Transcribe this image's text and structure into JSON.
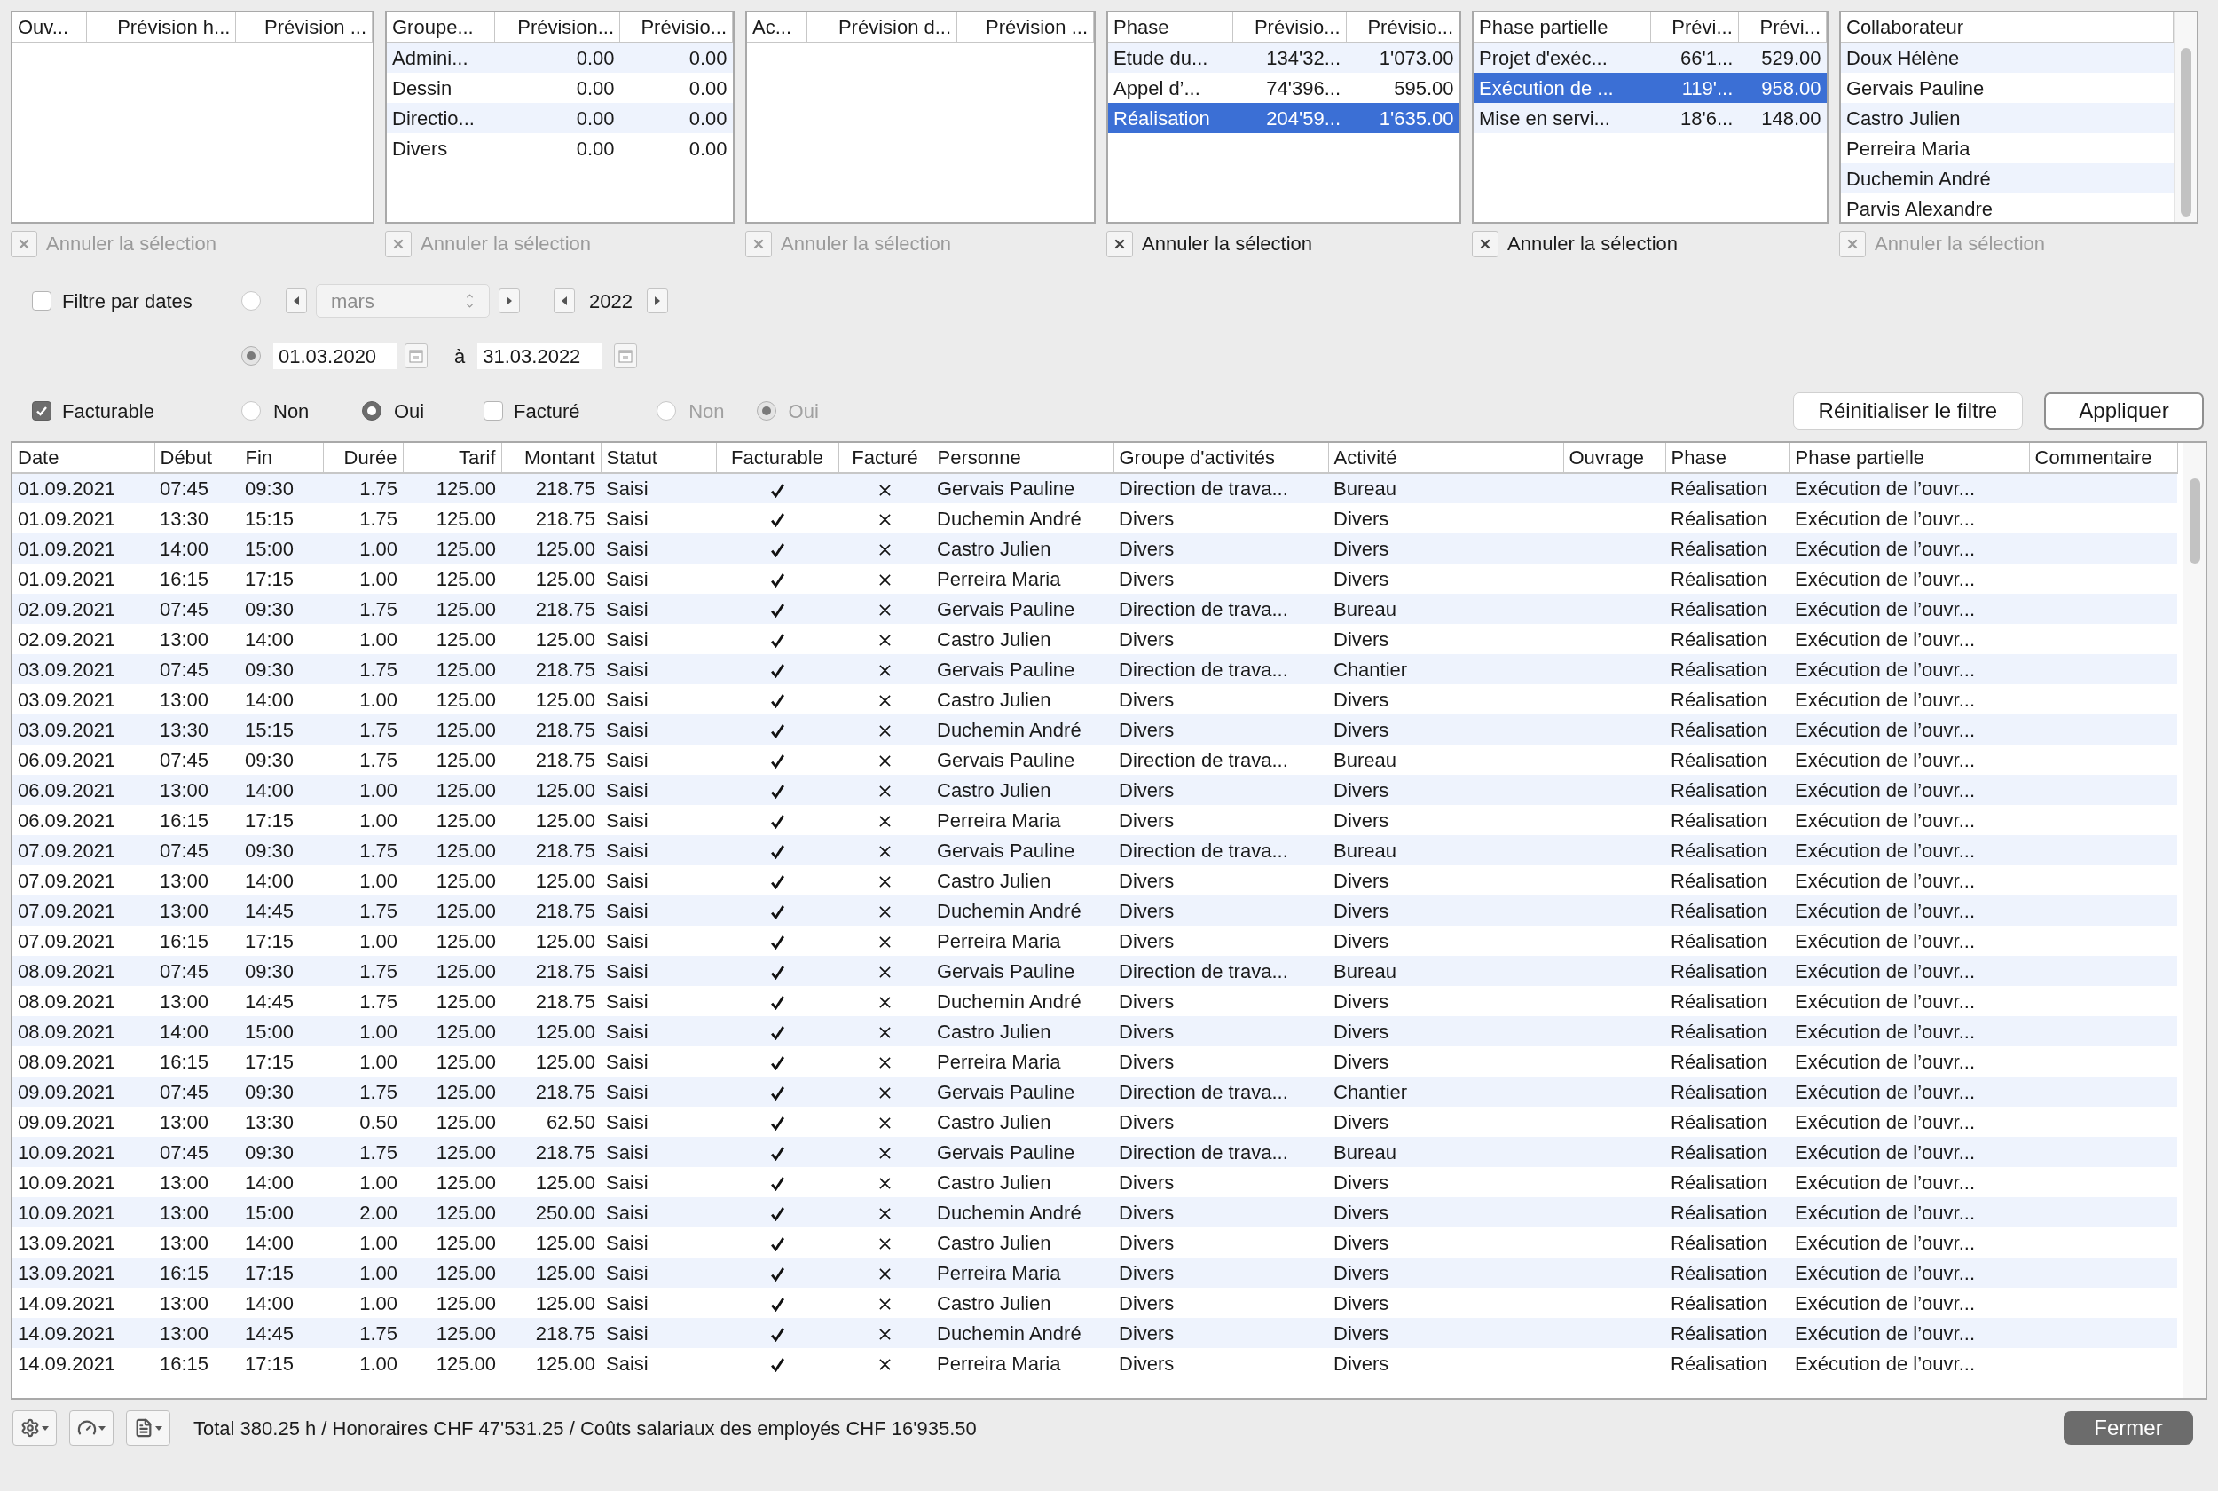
{
  "panels": [
    {
      "columns": [
        "Ouv...",
        "Prévision h...",
        "Prévision ..."
      ],
      "clear_button": {
        "label": "Annuler la sélection",
        "disabled": true
      }
    },
    {
      "columns": [
        "Groupe...",
        "Prévision...",
        "Prévisio..."
      ],
      "rows": [
        {
          "cells": [
            "Admini...",
            "0.00",
            "0.00"
          ],
          "selected": false
        },
        {
          "cells": [
            "Dessin",
            "0.00",
            "0.00"
          ],
          "selected": false
        },
        {
          "cells": [
            "Directio...",
            "0.00",
            "0.00"
          ],
          "selected": false
        },
        {
          "cells": [
            "Divers",
            "0.00",
            "0.00"
          ],
          "selected": false
        }
      ],
      "clear_button": {
        "label": "Annuler la sélection",
        "disabled": true
      }
    },
    {
      "columns": [
        "Ac...",
        "Prévision d...",
        "Prévision ..."
      ],
      "clear_button": {
        "label": "Annuler la sélection",
        "disabled": true
      }
    },
    {
      "columns": [
        "Phase",
        "Prévisio...",
        "Prévisio..."
      ],
      "rows": [
        {
          "cells": [
            "Etude du...",
            "134'32...",
            "1'073.00"
          ],
          "selected": false
        },
        {
          "cells": [
            "Appel d’...",
            "74'396...",
            "595.00"
          ],
          "selected": false
        },
        {
          "cells": [
            "Réalisation",
            "204'59...",
            "1'635.00"
          ],
          "selected": true
        }
      ],
      "clear_button": {
        "label": "Annuler la sélection",
        "disabled": false
      }
    },
    {
      "columns": [
        "Phase partielle",
        "Prévi...",
        "Prévi..."
      ],
      "rows": [
        {
          "cells": [
            "Projet d'exéc...",
            "66'1...",
            "529.00"
          ],
          "selected": false
        },
        {
          "cells": [
            "Exécution de ...",
            "119'...",
            "958.00"
          ],
          "selected": true
        },
        {
          "cells": [
            "Mise en servi...",
            "18'6...",
            "148.00"
          ],
          "selected": false
        }
      ],
      "clear_button": {
        "label": "Annuler la sélection",
        "disabled": false
      }
    },
    {
      "columns": [
        "Collaborateur"
      ],
      "scrollable": true,
      "rows": [
        {
          "cells": [
            "Doux Hélène"
          ],
          "selected": false
        },
        {
          "cells": [
            "Gervais Pauline"
          ],
          "selected": false
        },
        {
          "cells": [
            "Castro Julien"
          ],
          "selected": false
        },
        {
          "cells": [
            "Perreira Maria"
          ],
          "selected": false
        },
        {
          "cells": [
            "Duchemin André"
          ],
          "selected": false
        },
        {
          "cells": [
            "Parvis Alexandre"
          ],
          "selected": false
        }
      ],
      "clear_button": {
        "label": "Annuler la sélection",
        "disabled": true
      }
    }
  ],
  "date_filter": {
    "label": "Filtre par dates",
    "checked": false,
    "month_option": {
      "selected": false
    },
    "month": "mars",
    "year": "2022",
    "range_option": {
      "selected": true
    },
    "from": "01.03.2020",
    "separator": "à",
    "to": "31.03.2022"
  },
  "options": [
    {
      "label": "Facturable",
      "checked": true,
      "disabled": false,
      "choices": [
        {
          "label": "Non",
          "selected": false
        },
        {
          "label": "Oui",
          "selected": true
        }
      ]
    },
    {
      "label": "Facturé",
      "checked": false,
      "disabled": true,
      "choices": [
        {
          "label": "Non",
          "selected": false
        },
        {
          "label": "Oui",
          "selected": true
        }
      ]
    }
  ],
  "buttons": [
    {
      "label": "Réinitialiser le filtre",
      "default": false
    },
    {
      "label": "Appliquer",
      "default": true
    }
  ],
  "table": {
    "columns": [
      "Date",
      "Début",
      "Fin",
      "Durée",
      "Tarif",
      "Montant",
      "Statut",
      "Facturable",
      "Facturé",
      "Personne",
      "Groupe d'activités",
      "Activité",
      "Ouvrage",
      "Phase",
      "Phase partielle",
      "Commentaire"
    ],
    "rows": [
      [
        "01.09.2021",
        "07:45",
        "09:30",
        "1.75",
        "125.00",
        "218.75",
        "Saisi",
        true,
        false,
        "Gervais Pauline",
        "Direction de trava...",
        "Bureau",
        "",
        "Réalisation",
        "Exécution de l’ouvr...",
        ""
      ],
      [
        "01.09.2021",
        "13:30",
        "15:15",
        "1.75",
        "125.00",
        "218.75",
        "Saisi",
        true,
        false,
        "Duchemin André",
        "Divers",
        "Divers",
        "",
        "Réalisation",
        "Exécution de l’ouvr...",
        ""
      ],
      [
        "01.09.2021",
        "14:00",
        "15:00",
        "1.00",
        "125.00",
        "125.00",
        "Saisi",
        true,
        false,
        "Castro Julien",
        "Divers",
        "Divers",
        "",
        "Réalisation",
        "Exécution de l’ouvr...",
        ""
      ],
      [
        "01.09.2021",
        "16:15",
        "17:15",
        "1.00",
        "125.00",
        "125.00",
        "Saisi",
        true,
        false,
        "Perreira Maria",
        "Divers",
        "Divers",
        "",
        "Réalisation",
        "Exécution de l’ouvr...",
        ""
      ],
      [
        "02.09.2021",
        "07:45",
        "09:30",
        "1.75",
        "125.00",
        "218.75",
        "Saisi",
        true,
        false,
        "Gervais Pauline",
        "Direction de trava...",
        "Bureau",
        "",
        "Réalisation",
        "Exécution de l’ouvr...",
        ""
      ],
      [
        "02.09.2021",
        "13:00",
        "14:00",
        "1.00",
        "125.00",
        "125.00",
        "Saisi",
        true,
        false,
        "Castro Julien",
        "Divers",
        "Divers",
        "",
        "Réalisation",
        "Exécution de l’ouvr...",
        ""
      ],
      [
        "03.09.2021",
        "07:45",
        "09:30",
        "1.75",
        "125.00",
        "218.75",
        "Saisi",
        true,
        false,
        "Gervais Pauline",
        "Direction de trava...",
        "Chantier",
        "",
        "Réalisation",
        "Exécution de l’ouvr...",
        ""
      ],
      [
        "03.09.2021",
        "13:00",
        "14:00",
        "1.00",
        "125.00",
        "125.00",
        "Saisi",
        true,
        false,
        "Castro Julien",
        "Divers",
        "Divers",
        "",
        "Réalisation",
        "Exécution de l’ouvr...",
        ""
      ],
      [
        "03.09.2021",
        "13:30",
        "15:15",
        "1.75",
        "125.00",
        "218.75",
        "Saisi",
        true,
        false,
        "Duchemin André",
        "Divers",
        "Divers",
        "",
        "Réalisation",
        "Exécution de l’ouvr...",
        ""
      ],
      [
        "06.09.2021",
        "07:45",
        "09:30",
        "1.75",
        "125.00",
        "218.75",
        "Saisi",
        true,
        false,
        "Gervais Pauline",
        "Direction de trava...",
        "Bureau",
        "",
        "Réalisation",
        "Exécution de l’ouvr...",
        ""
      ],
      [
        "06.09.2021",
        "13:00",
        "14:00",
        "1.00",
        "125.00",
        "125.00",
        "Saisi",
        true,
        false,
        "Castro Julien",
        "Divers",
        "Divers",
        "",
        "Réalisation",
        "Exécution de l’ouvr...",
        ""
      ],
      [
        "06.09.2021",
        "16:15",
        "17:15",
        "1.00",
        "125.00",
        "125.00",
        "Saisi",
        true,
        false,
        "Perreira Maria",
        "Divers",
        "Divers",
        "",
        "Réalisation",
        "Exécution de l’ouvr...",
        ""
      ],
      [
        "07.09.2021",
        "07:45",
        "09:30",
        "1.75",
        "125.00",
        "218.75",
        "Saisi",
        true,
        false,
        "Gervais Pauline",
        "Direction de trava...",
        "Bureau",
        "",
        "Réalisation",
        "Exécution de l’ouvr...",
        ""
      ],
      [
        "07.09.2021",
        "13:00",
        "14:00",
        "1.00",
        "125.00",
        "125.00",
        "Saisi",
        true,
        false,
        "Castro Julien",
        "Divers",
        "Divers",
        "",
        "Réalisation",
        "Exécution de l’ouvr...",
        ""
      ],
      [
        "07.09.2021",
        "13:00",
        "14:45",
        "1.75",
        "125.00",
        "218.75",
        "Saisi",
        true,
        false,
        "Duchemin André",
        "Divers",
        "Divers",
        "",
        "Réalisation",
        "Exécution de l’ouvr...",
        ""
      ],
      [
        "07.09.2021",
        "16:15",
        "17:15",
        "1.00",
        "125.00",
        "125.00",
        "Saisi",
        true,
        false,
        "Perreira Maria",
        "Divers",
        "Divers",
        "",
        "Réalisation",
        "Exécution de l’ouvr...",
        ""
      ],
      [
        "08.09.2021",
        "07:45",
        "09:30",
        "1.75",
        "125.00",
        "218.75",
        "Saisi",
        true,
        false,
        "Gervais Pauline",
        "Direction de trava...",
        "Bureau",
        "",
        "Réalisation",
        "Exécution de l’ouvr...",
        ""
      ],
      [
        "08.09.2021",
        "13:00",
        "14:45",
        "1.75",
        "125.00",
        "218.75",
        "Saisi",
        true,
        false,
        "Duchemin André",
        "Divers",
        "Divers",
        "",
        "Réalisation",
        "Exécution de l’ouvr...",
        ""
      ],
      [
        "08.09.2021",
        "14:00",
        "15:00",
        "1.00",
        "125.00",
        "125.00",
        "Saisi",
        true,
        false,
        "Castro Julien",
        "Divers",
        "Divers",
        "",
        "Réalisation",
        "Exécution de l’ouvr...",
        ""
      ],
      [
        "08.09.2021",
        "16:15",
        "17:15",
        "1.00",
        "125.00",
        "125.00",
        "Saisi",
        true,
        false,
        "Perreira Maria",
        "Divers",
        "Divers",
        "",
        "Réalisation",
        "Exécution de l’ouvr...",
        ""
      ],
      [
        "09.09.2021",
        "07:45",
        "09:30",
        "1.75",
        "125.00",
        "218.75",
        "Saisi",
        true,
        false,
        "Gervais Pauline",
        "Direction de trava...",
        "Chantier",
        "",
        "Réalisation",
        "Exécution de l’ouvr...",
        ""
      ],
      [
        "09.09.2021",
        "13:00",
        "13:30",
        "0.50",
        "125.00",
        "62.50",
        "Saisi",
        true,
        false,
        "Castro Julien",
        "Divers",
        "Divers",
        "",
        "Réalisation",
        "Exécution de l’ouvr...",
        ""
      ],
      [
        "10.09.2021",
        "07:45",
        "09:30",
        "1.75",
        "125.00",
        "218.75",
        "Saisi",
        true,
        false,
        "Gervais Pauline",
        "Direction de trava...",
        "Bureau",
        "",
        "Réalisation",
        "Exécution de l’ouvr...",
        ""
      ],
      [
        "10.09.2021",
        "13:00",
        "14:00",
        "1.00",
        "125.00",
        "125.00",
        "Saisi",
        true,
        false,
        "Castro Julien",
        "Divers",
        "Divers",
        "",
        "Réalisation",
        "Exécution de l’ouvr...",
        ""
      ],
      [
        "10.09.2021",
        "13:00",
        "15:00",
        "2.00",
        "125.00",
        "250.00",
        "Saisi",
        true,
        false,
        "Duchemin André",
        "Divers",
        "Divers",
        "",
        "Réalisation",
        "Exécution de l’ouvr...",
        ""
      ],
      [
        "13.09.2021",
        "13:00",
        "14:00",
        "1.00",
        "125.00",
        "125.00",
        "Saisi",
        true,
        false,
        "Castro Julien",
        "Divers",
        "Divers",
        "",
        "Réalisation",
        "Exécution de l’ouvr...",
        ""
      ],
      [
        "13.09.2021",
        "16:15",
        "17:15",
        "1.00",
        "125.00",
        "125.00",
        "Saisi",
        true,
        false,
        "Perreira Maria",
        "Divers",
        "Divers",
        "",
        "Réalisation",
        "Exécution de l’ouvr...",
        ""
      ],
      [
        "14.09.2021",
        "13:00",
        "14:00",
        "1.00",
        "125.00",
        "125.00",
        "Saisi",
        true,
        false,
        "Castro Julien",
        "Divers",
        "Divers",
        "",
        "Réalisation",
        "Exécution de l’ouvr...",
        ""
      ],
      [
        "14.09.2021",
        "13:00",
        "14:45",
        "1.75",
        "125.00",
        "218.75",
        "Saisi",
        true,
        false,
        "Duchemin André",
        "Divers",
        "Divers",
        "",
        "Réalisation",
        "Exécution de l’ouvr...",
        ""
      ],
      [
        "14.09.2021",
        "16:15",
        "17:15",
        "1.00",
        "125.00",
        "125.00",
        "Saisi",
        true,
        false,
        "Perreira Maria",
        "Divers",
        "Divers",
        "",
        "Réalisation",
        "Exécution de l’ouvr...",
        ""
      ]
    ]
  },
  "status_bar": {
    "summary": "Total 380.25 h / Honoraires CHF 47'531.25 / Coûts salariaux des employés CHF 16'935.50",
    "close_button": "Fermer"
  }
}
